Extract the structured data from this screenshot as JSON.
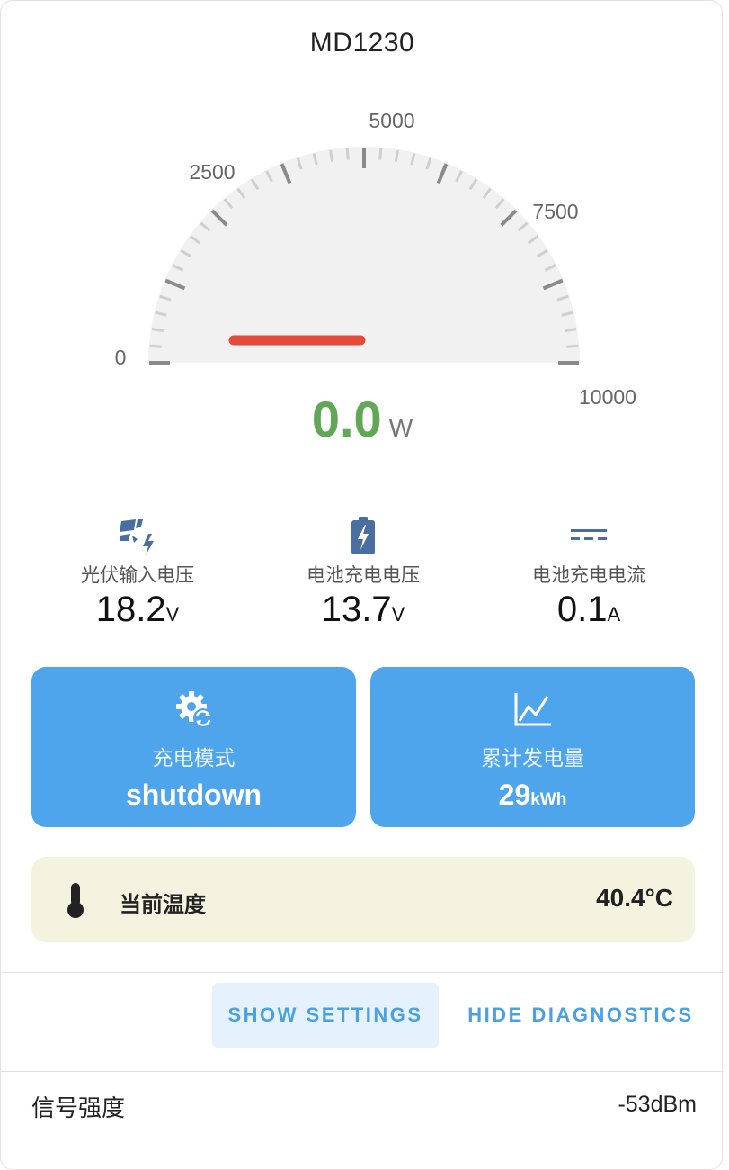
{
  "device": {
    "name": "MD1230"
  },
  "gauge": {
    "value": 0.0,
    "value_text": "0.0",
    "unit": "W",
    "min": 0,
    "max": 10000,
    "labels": [
      "0",
      "2500",
      "5000",
      "7500",
      "10000"
    ],
    "value_color": "#60a856",
    "needle_color": "#e34c3b"
  },
  "metrics": [
    {
      "label": "光伏输入电压",
      "value": "18.2",
      "unit": "V",
      "icon": "solar-panel-icon"
    },
    {
      "label": "电池充电电压",
      "value": "13.7",
      "unit": "V",
      "icon": "battery-charging-icon"
    },
    {
      "label": "电池充电电流",
      "value": "0.1",
      "unit": "A",
      "icon": "dc-current-icon"
    }
  ],
  "tiles": [
    {
      "label": "充电模式",
      "value": "shutdown",
      "unit": "",
      "icon": "gear-sync-icon"
    },
    {
      "label": "累计发电量",
      "value": "29",
      "unit": "kWh",
      "icon": "line-chart-icon"
    }
  ],
  "temperature": {
    "label": "当前温度",
    "value": "40.4°C",
    "icon": "thermometer-icon"
  },
  "actions": {
    "show_settings": "SHOW SETTINGS",
    "hide_diagnostics": "HIDE DIAGNOSTICS"
  },
  "diagnostics": [
    {
      "label": "信号强度",
      "value": "-53dBm"
    }
  ],
  "colors": {
    "accent": "#4ea5ec",
    "tile_bg": "#4ea5ec",
    "temp_bg": "#f4f3df"
  }
}
